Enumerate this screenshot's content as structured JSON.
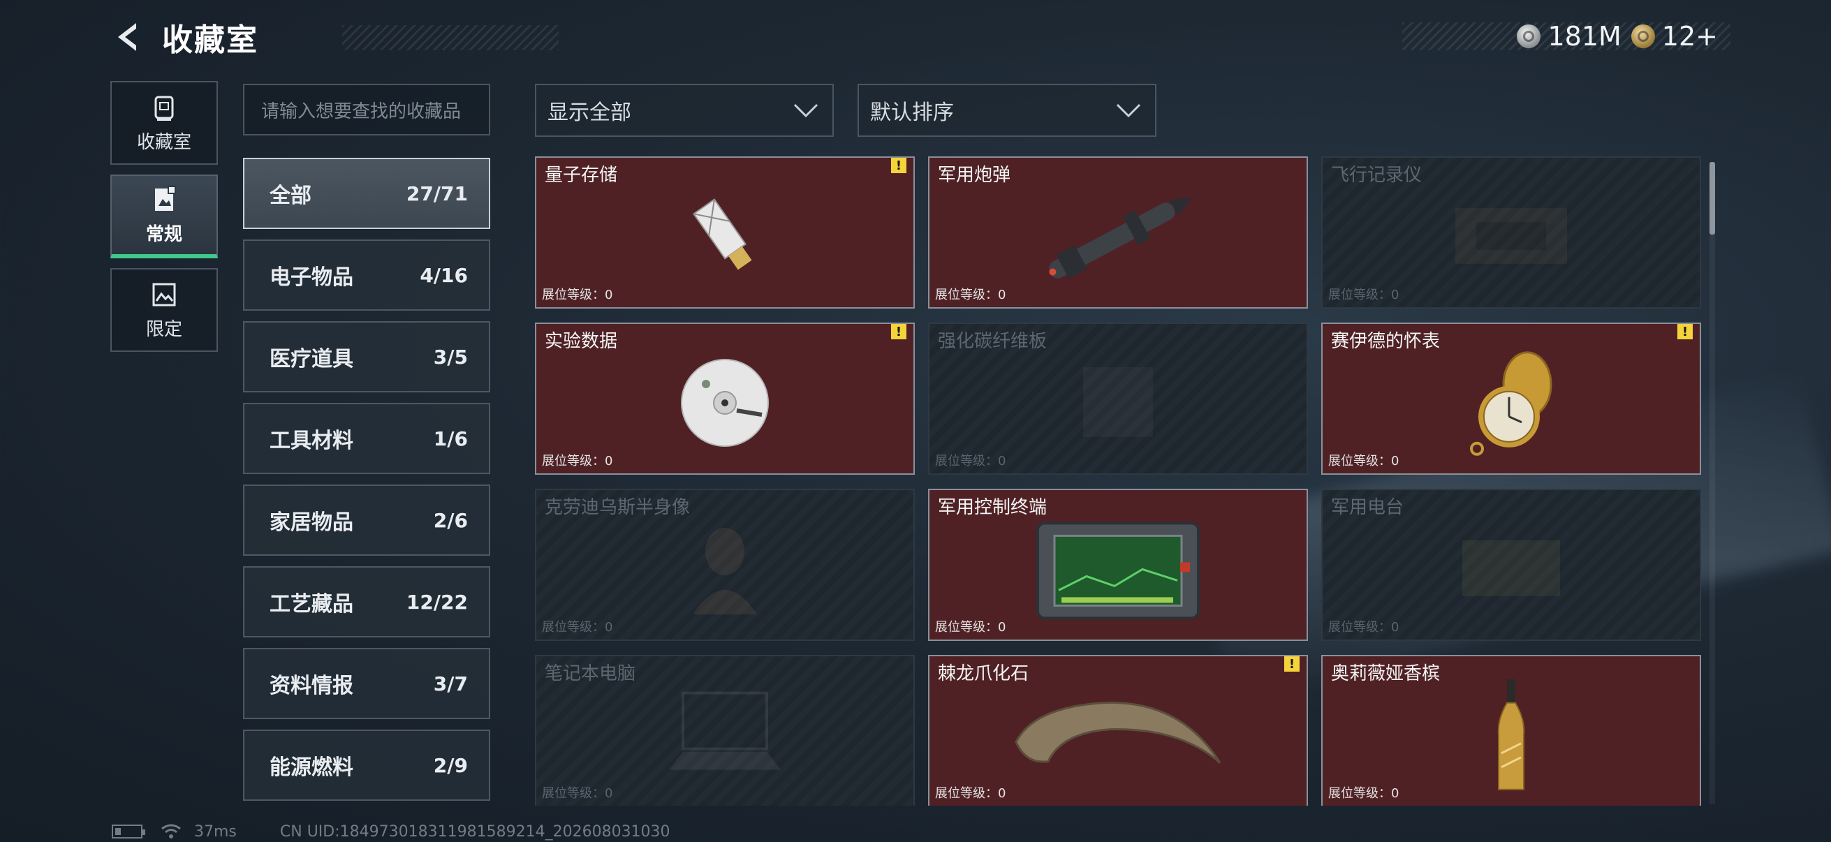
{
  "header": {
    "title": "收藏室",
    "currencies": [
      {
        "icon": "silver-coin-icon",
        "value": "181M"
      },
      {
        "icon": "gold-coin-icon",
        "value": "12+"
      }
    ]
  },
  "leftnav": [
    {
      "label": "收藏室",
      "icon": "vault-icon",
      "active": false
    },
    {
      "label": "常规",
      "icon": "document-icon",
      "active": true
    },
    {
      "label": "限定",
      "icon": "limited-image-icon",
      "active": false
    }
  ],
  "search": {
    "placeholder": "请输入想要查找的收藏品"
  },
  "categories": [
    {
      "label": "全部",
      "count": "27/71",
      "active": true
    },
    {
      "label": "电子物品",
      "count": "4/16"
    },
    {
      "label": "医疗道具",
      "count": "3/5"
    },
    {
      "label": "工具材料",
      "count": "1/6"
    },
    {
      "label": "家居物品",
      "count": "2/6"
    },
    {
      "label": "工艺藏品",
      "count": "12/22"
    },
    {
      "label": "资料情报",
      "count": "3/7"
    },
    {
      "label": "能源燃料",
      "count": "2/9"
    }
  ],
  "filters": {
    "show": {
      "label": "显示全部"
    },
    "sort": {
      "label": "默认排序"
    }
  },
  "level_label": "展位等级：",
  "items": [
    {
      "name": "量子存储",
      "level": "0",
      "owned": true,
      "alert": true,
      "icon": "usb-drive-icon"
    },
    {
      "name": "军用炮弹",
      "level": "0",
      "owned": true,
      "alert": false,
      "icon": "missile-icon"
    },
    {
      "name": "飞行记录仪",
      "level": "0",
      "owned": false,
      "alert": false,
      "icon": "flight-recorder-icon"
    },
    {
      "name": "实验数据",
      "level": "0",
      "owned": true,
      "alert": true,
      "icon": "disc-icon"
    },
    {
      "name": "强化碳纤维板",
      "level": "0",
      "owned": false,
      "alert": false,
      "icon": "carbon-plate-icon"
    },
    {
      "name": "赛伊德的怀表",
      "level": "0",
      "owned": true,
      "alert": true,
      "icon": "pocket-watch-icon"
    },
    {
      "name": "克劳迪乌斯半身像",
      "level": "0",
      "owned": false,
      "alert": false,
      "icon": "bust-icon"
    },
    {
      "name": "军用控制终端",
      "level": "0",
      "owned": true,
      "alert": false,
      "icon": "control-terminal-icon"
    },
    {
      "name": "军用电台",
      "level": "0",
      "owned": false,
      "alert": false,
      "icon": "radio-icon"
    },
    {
      "name": "笔记本电脑",
      "level": "0",
      "owned": false,
      "alert": false,
      "icon": "laptop-icon"
    },
    {
      "name": "棘龙爪化石",
      "level": "0",
      "owned": true,
      "alert": true,
      "icon": "claw-fossil-icon"
    },
    {
      "name": "奥莉薇娅香槟",
      "level": "0",
      "owned": true,
      "alert": false,
      "icon": "champagne-icon"
    }
  ],
  "status": {
    "ping": "37ms",
    "uid": "CN UID:18497301831198158921​4_202608031030"
  }
}
